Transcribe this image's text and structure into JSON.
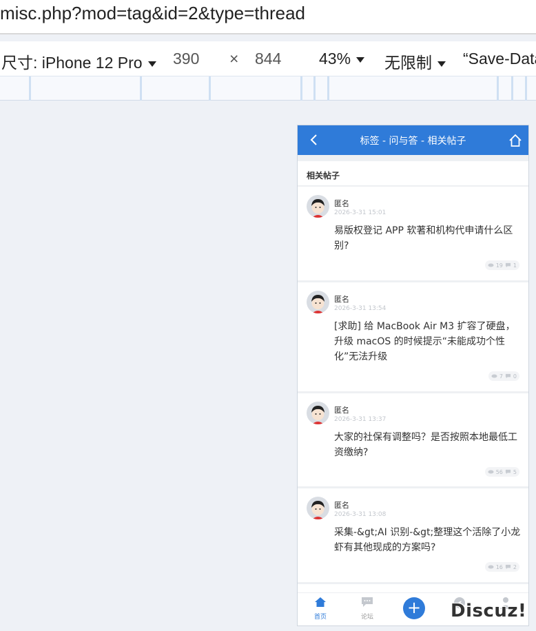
{
  "browser": {
    "url": "misc.php?mod=tag&id=2&type=thread"
  },
  "devtools": {
    "device_label": "尺寸: iPhone 12 Pro",
    "width": "390",
    "times": "×",
    "height": "844",
    "zoom": "43%",
    "throttle": "无限制",
    "save_data": "“Save-Data"
  },
  "mobile": {
    "header_title": "标签 - 问与答 - 相关帖子",
    "section_title": "相关帖子",
    "posts": [
      {
        "author": "匿名",
        "time": "2026-3-31 15:01",
        "title": "易版权登记 APP 软著和机构代申请什么区别?",
        "views": "19",
        "replies": "1"
      },
      {
        "author": "匿名",
        "time": "2026-3-31 13:54",
        "title": "[求助] 给 MacBook Air M3 扩容了硬盘，升级 macOS 的时候提示“未能成功个性化”无法升级",
        "views": "7",
        "replies": "0"
      },
      {
        "author": "匿名",
        "time": "2026-3-31 13:37",
        "title": "大家的社保有调整吗？是否按照本地最低工资缴纳?",
        "views": "56",
        "replies": "5"
      },
      {
        "author": "匿名",
        "time": "2026-3-31 13:08",
        "title": "采集-&gt;AI 识别-&gt;整理这个活除了小龙虾有其他现成的方案吗?",
        "views": "16",
        "replies": "2"
      }
    ],
    "tabbar": {
      "home": "首页",
      "forum": "论坛",
      "post_icon": "+"
    }
  },
  "watermark": "Discuz!",
  "colors": {
    "accent": "#2f7bd9",
    "background": "#eef1f6"
  }
}
